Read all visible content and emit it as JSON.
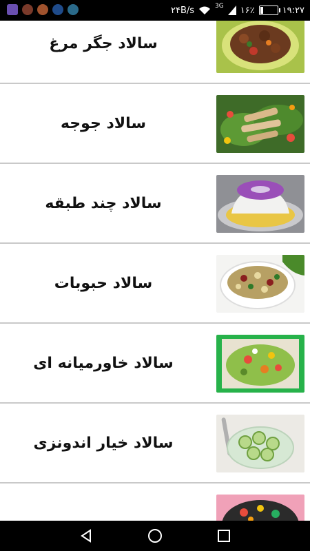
{
  "status_bar": {
    "time": "۱۹:۲۷",
    "battery": "۱۶٪",
    "network_speed": "۲۴B/s",
    "network_type": "3G"
  },
  "salads": [
    {
      "label": "سالاد جگر مرغ",
      "thumb_icon": "liver-salad-image"
    },
    {
      "label": "سالاد جوجه",
      "thumb_icon": "chicken-salad-image"
    },
    {
      "label": "سالاد چند طبقه",
      "thumb_icon": "layered-salad-image"
    },
    {
      "label": "سالاد حبوبات",
      "thumb_icon": "legumes-salad-image"
    },
    {
      "label": "سالاد خاورمیانه ای",
      "thumb_icon": "middle-eastern-salad-image"
    },
    {
      "label": "سالاد خیار اندونزی",
      "thumb_icon": "indonesian-cucumber-salad-image"
    },
    {
      "label": "",
      "thumb_icon": "partial-salad-image"
    }
  ],
  "nav": {
    "back_icon": "back-triangle-icon",
    "home_icon": "home-circle-icon",
    "recents_icon": "recents-square-icon"
  }
}
